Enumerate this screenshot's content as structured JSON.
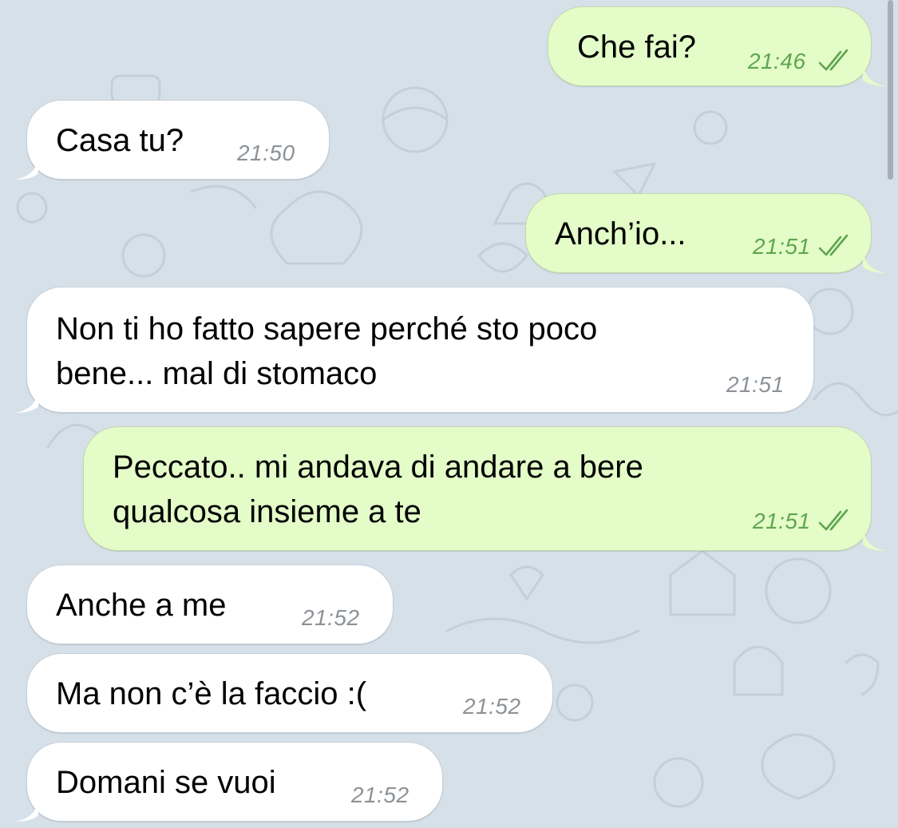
{
  "wallpaper": {
    "icon": "doodle-pattern-background",
    "color": "#d6e0e9"
  },
  "colors": {
    "incoming_bubble": "#ffffff",
    "outgoing_bubble": "#e3fcc8",
    "outgoing_time": "#5fa54f",
    "incoming_time": "#8c9297"
  },
  "messages": [
    {
      "direction": "outgoing",
      "text": "Che fai?",
      "time": "21:46",
      "read": true
    },
    {
      "direction": "incoming",
      "text": "Casa tu?",
      "time": "21:50"
    },
    {
      "direction": "outgoing",
      "text": "Anch’io...",
      "time": "21:51",
      "read": true
    },
    {
      "direction": "incoming",
      "text": "Non ti ho fatto sapere perché sto poco\nbene... mal di stomaco",
      "time": "21:51"
    },
    {
      "direction": "outgoing",
      "text": "Peccato.. mi andava di andare a bere\nqualcosa insieme a te",
      "time": "21:51",
      "read": true
    },
    {
      "direction": "incoming",
      "text": "Anche a me",
      "time": "21:52"
    },
    {
      "direction": "incoming",
      "text": "Ma non c’è la faccio :(",
      "time": "21:52"
    },
    {
      "direction": "incoming",
      "text": "Domani se vuoi",
      "time": "21:52"
    }
  ]
}
